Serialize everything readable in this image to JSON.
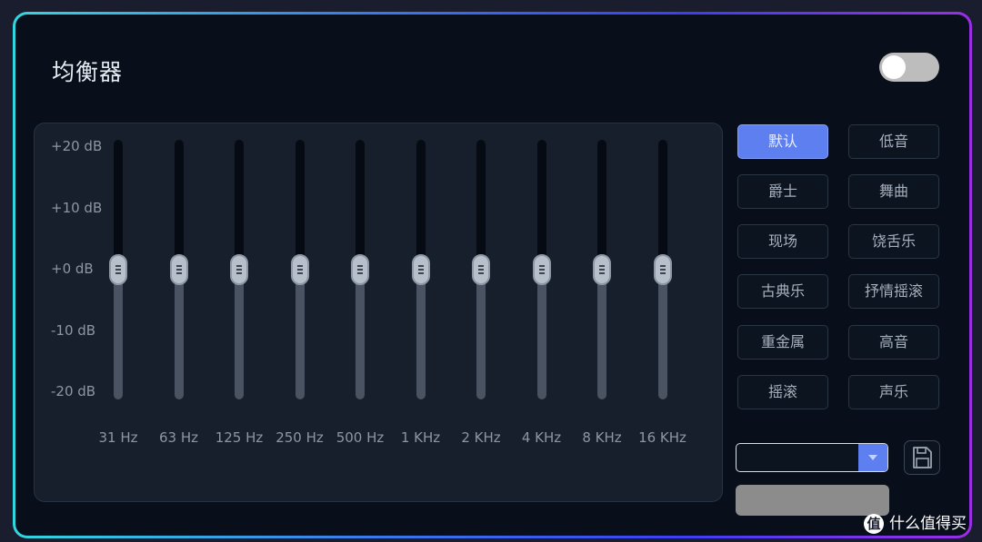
{
  "title": "均衡器",
  "toggle": {
    "on": false
  },
  "eq": {
    "db_labels": [
      "+20 dB",
      "+10 dB",
      "+0 dB",
      "-10 dB",
      "-20 dB"
    ],
    "bands": [
      {
        "label": "31 Hz",
        "value_db": 0
      },
      {
        "label": "63 Hz",
        "value_db": 0
      },
      {
        "label": "125 Hz",
        "value_db": 0
      },
      {
        "label": "250 Hz",
        "value_db": 0
      },
      {
        "label": "500 Hz",
        "value_db": 0
      },
      {
        "label": "1 KHz",
        "value_db": 0
      },
      {
        "label": "2 KHz",
        "value_db": 0
      },
      {
        "label": "4 KHz",
        "value_db": 0
      },
      {
        "label": "8 KHz",
        "value_db": 0
      },
      {
        "label": "16 KHz",
        "value_db": 0
      }
    ]
  },
  "presets": [
    {
      "label": "默认",
      "active": true
    },
    {
      "label": "低音",
      "active": false
    },
    {
      "label": "爵士",
      "active": false
    },
    {
      "label": "舞曲",
      "active": false
    },
    {
      "label": "现场",
      "active": false
    },
    {
      "label": "饶舌乐",
      "active": false
    },
    {
      "label": "古典乐",
      "active": false
    },
    {
      "label": "抒情摇滚",
      "active": false
    },
    {
      "label": "重金属",
      "active": false
    },
    {
      "label": "高音",
      "active": false
    },
    {
      "label": "摇滚",
      "active": false
    },
    {
      "label": "声乐",
      "active": false
    }
  ],
  "custom": {
    "dropdown_value": "",
    "save_icon": "floppy-disk-icon",
    "apply_label": ""
  },
  "watermark": {
    "icon_char": "值",
    "text": "什么值得买"
  },
  "colors": {
    "accent": "#5d7ff0",
    "panel_bg": "#080e1a",
    "eq_bg": "#161f2b"
  }
}
